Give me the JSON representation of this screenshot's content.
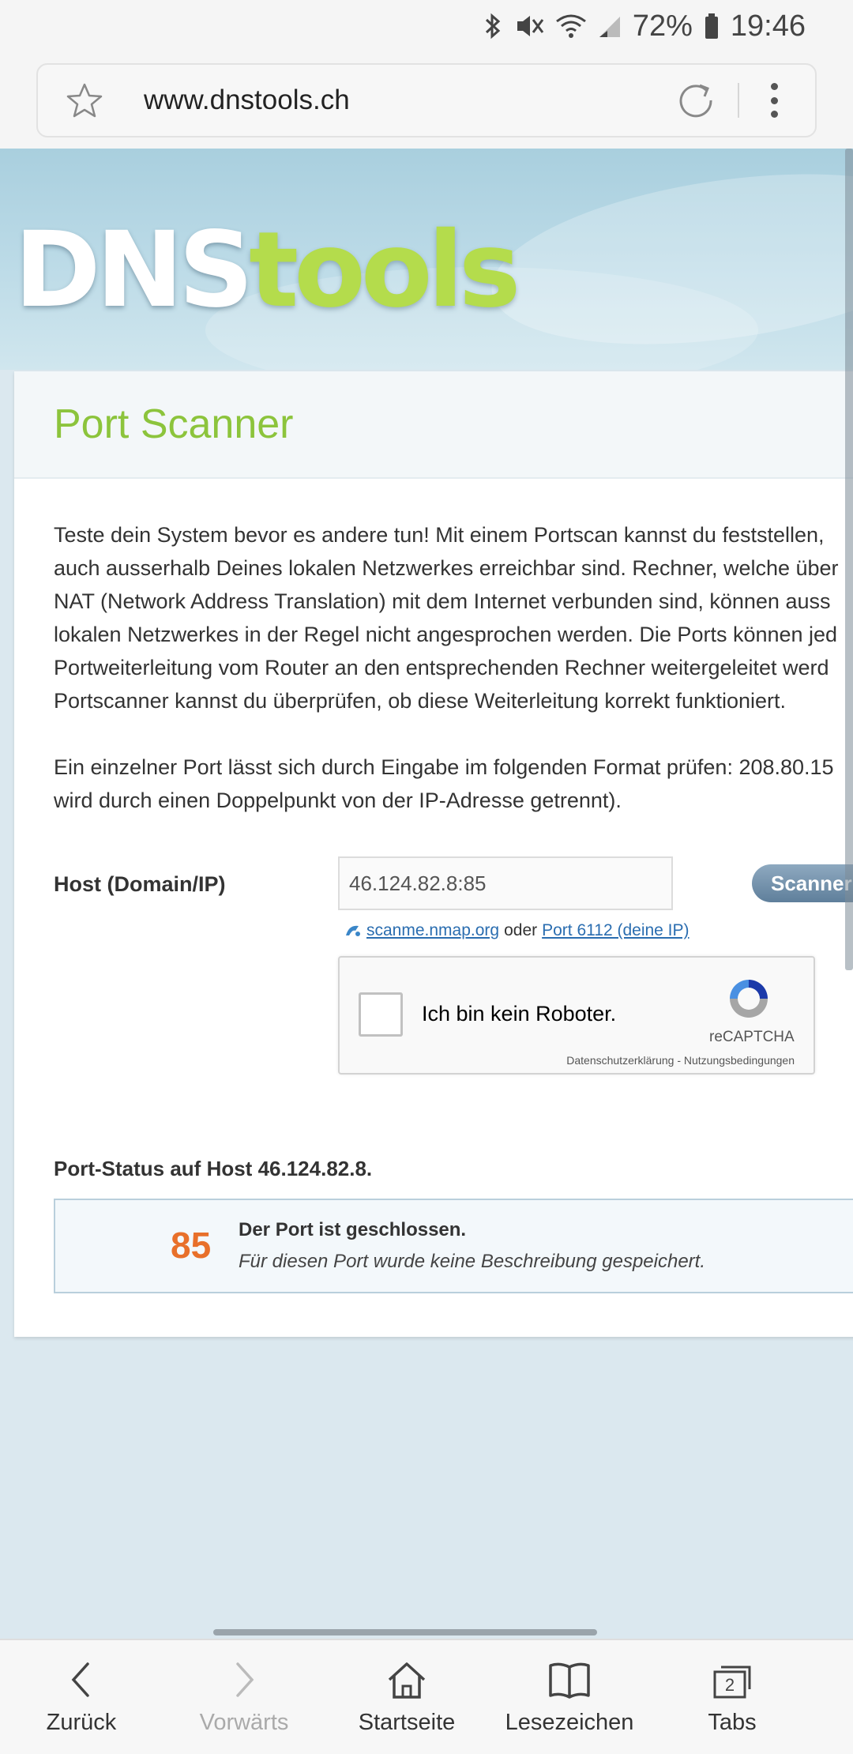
{
  "status_bar": {
    "battery": "72%",
    "time": "19:46"
  },
  "browser": {
    "url": "www.dnstools.ch"
  },
  "site": {
    "logo_dns": "DNS",
    "logo_tools": "tools"
  },
  "card": {
    "title": "Port Scanner",
    "paragraph1": [
      "Teste dein System bevor es andere tun! Mit einem Portscan kannst du feststellen,",
      "auch ausserhalb Deines lokalen Netzwerkes erreichbar sind. Rechner, welche über",
      "NAT (Network Address Translation) mit dem Internet verbunden sind, können auss",
      "lokalen Netzwerkes in der Regel nicht angesprochen werden. Die Ports können jed",
      "Portweiterleitung vom Router an den entsprechenden Rechner weitergeleitet werd",
      "Portscanner kannst du überprüfen, ob diese Weiterleitung korrekt funktioniert."
    ],
    "paragraph2": [
      "Ein einzelner Port lässt sich durch Eingabe im folgenden Format prüfen: 208.80.15",
      "wird durch einen Doppelpunkt von der IP-Adresse getrennt)."
    ]
  },
  "form": {
    "host_label": "Host (Domain/IP)",
    "host_value": "46.124.82.8:85",
    "scan_button": "Scanner",
    "link1": "scanme.nmap.org",
    "link_sep": "oder",
    "link2": "Port 6112 (deine IP)"
  },
  "captcha": {
    "label": "Ich bin kein Roboter.",
    "brand": "reCAPTCHA",
    "terms": "Datenschutzerklärung - Nutzungsbedingungen"
  },
  "result": {
    "heading": "Port-Status auf Host 46.124.82.8.",
    "port": "85",
    "title": "Der Port ist geschlossen.",
    "description": "Für diesen Port wurde keine Beschreibung gespeichert."
  },
  "bottom_nav": {
    "back": "Zurück",
    "forward": "Vorwärts",
    "home": "Startseite",
    "bookmarks": "Lesezeichen",
    "tabs": "Tabs",
    "tab_count": "2"
  }
}
